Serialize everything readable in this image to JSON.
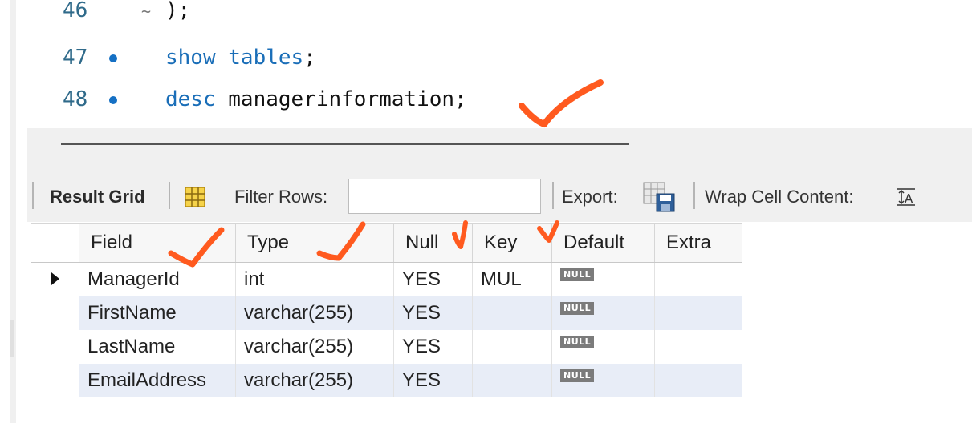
{
  "editor": {
    "lines": [
      {
        "number": "46",
        "fold": "~",
        "code": ");"
      },
      {
        "number": "47",
        "keywords": "show tables",
        "rest": ";"
      },
      {
        "number": "48",
        "keyword": "desc",
        "rest": " managerinformation;"
      }
    ]
  },
  "toolbar": {
    "result_grid": "Result Grid",
    "filter_rows": "Filter Rows:",
    "filter_value": "",
    "export": "Export:",
    "wrap_cell": "Wrap Cell Content:",
    "icons": [
      "grid-form-icon",
      "export-icon",
      "wrap-text-icon"
    ]
  },
  "grid": {
    "columns": [
      "Field",
      "Type",
      "Null",
      "Key",
      "Default",
      "Extra"
    ],
    "rows": [
      {
        "field": "ManagerId",
        "type": "int",
        "null": "YES",
        "key": "MUL",
        "default": "NULL",
        "extra": ""
      },
      {
        "field": "FirstName",
        "type": "varchar(255)",
        "null": "YES",
        "key": "",
        "default": "NULL",
        "extra": ""
      },
      {
        "field": "LastName",
        "type": "varchar(255)",
        "null": "YES",
        "key": "",
        "default": "NULL",
        "extra": ""
      },
      {
        "field": "EmailAddress",
        "type": "varchar(255)",
        "null": "YES",
        "key": "",
        "default": "NULL",
        "extra": ""
      }
    ]
  },
  "colors": {
    "keyword": "#1a6eb8",
    "annotation": "#ff5a1f",
    "alt_row": "#e8edf7"
  }
}
